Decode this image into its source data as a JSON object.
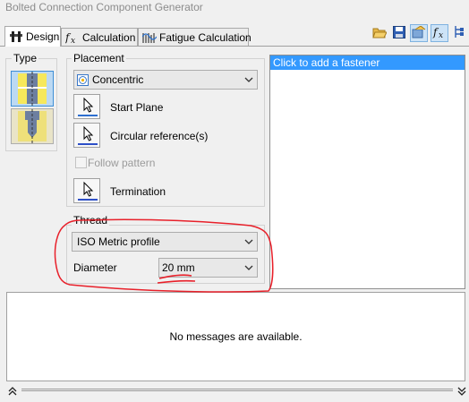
{
  "window": {
    "title": "Bolted Connection Component Generator"
  },
  "tabs": [
    {
      "label": "Design",
      "icon": "design-icon",
      "active": true
    },
    {
      "label": "Calculation",
      "icon": "calculation-icon",
      "active": false
    },
    {
      "label": "Fatigue Calculation",
      "icon": "fatigue-icon",
      "active": false
    }
  ],
  "toolbar": {
    "icons": [
      "open-folder-icon",
      "save-icon",
      "settings-icon",
      "function-icon",
      "tree-icon"
    ]
  },
  "type": {
    "label": "Type"
  },
  "placement": {
    "label": "Placement",
    "combo_value": "Concentric",
    "start_plane": "Start Plane",
    "circular_reference": "Circular reference(s)",
    "follow_pattern": "Follow pattern",
    "termination": "Termination"
  },
  "thread": {
    "label": "Thread",
    "profile_value": "ISO Metric profile",
    "diameter_label": "Diameter",
    "diameter_value": "20 mm"
  },
  "fasteners": {
    "add_item": "Click to add a fastener"
  },
  "messages": {
    "empty_text": "No messages are available."
  },
  "colors": {
    "selection": "#3399ff",
    "annotation": "#e8202a"
  }
}
